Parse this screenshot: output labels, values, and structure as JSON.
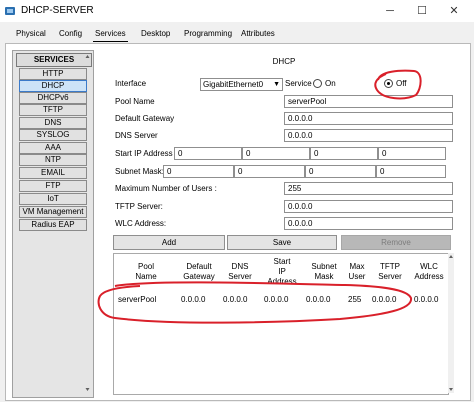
{
  "window": {
    "title": "DHCP-SERVER",
    "minimize_glyph": "─",
    "maximize_glyph": "☐",
    "close_glyph": "✕"
  },
  "tabs": [
    "Physical",
    "Config",
    "Services",
    "Desktop",
    "Programming",
    "Attributes"
  ],
  "active_tab": "Services",
  "services": {
    "header": "SERVICES",
    "items": [
      "HTTP",
      "DHCP",
      "DHCPv6",
      "TFTP",
      "DNS",
      "SYSLOG",
      "AAA",
      "NTP",
      "EMAIL",
      "FTP",
      "IoT",
      "VM Management",
      "Radius EAP"
    ],
    "active": "DHCP"
  },
  "dhcp": {
    "title": "DHCP",
    "interface_label": "Interface",
    "interface_value": "GigabitEthernet0",
    "service_label": "Service",
    "on_label": "On",
    "off_label": "Off",
    "service_state": "Off",
    "pool_name_label": "Pool Name",
    "pool_name_value": "serverPool",
    "default_gateway_label": "Default Gateway",
    "default_gateway_value": "0.0.0.0",
    "dns_server_label": "DNS Server",
    "dns_server_value": "0.0.0.0",
    "start_ip_label": "Start IP Address :",
    "start_ip_octets": [
      "0",
      "0",
      "0",
      "0"
    ],
    "subnet_mask_label": "Subnet Mask:",
    "subnet_mask_octets": [
      "0",
      "0",
      "0",
      "0"
    ],
    "max_users_label": "Maximum Number of Users :",
    "max_users_value": "255",
    "tftp_server_label": "TFTP Server:",
    "tftp_server_value": "0.0.0.0",
    "wlc_address_label": "WLC Address:",
    "wlc_address_value": "0.0.0.0",
    "add_label": "Add",
    "save_label": "Save",
    "remove_label": "Remove"
  },
  "table": {
    "headers": [
      [
        "Pool",
        "Name"
      ],
      [
        "Default",
        "Gateway"
      ],
      [
        "DNS",
        "Server"
      ],
      [
        "Start",
        "IP",
        "Address"
      ],
      [
        "Subnet",
        "Mask"
      ],
      [
        "Max",
        "User"
      ],
      [
        "TFTP",
        "Server"
      ],
      [
        "WLC",
        "Address"
      ]
    ],
    "rows": [
      [
        "serverPool",
        "0.0.0.0",
        "0.0.0.0",
        "0.0.0.0",
        "0.0.0.0",
        "255",
        "0.0.0.0",
        "0.0.0.0"
      ]
    ]
  },
  "colors": {
    "annotation_red": "#d9202a",
    "active_service_bg": "#cde3f7",
    "active_service_border": "#3b7ac9"
  },
  "icons": {
    "app": "packet-tracer-device-icon",
    "dropdown": "chevron-down-icon"
  }
}
